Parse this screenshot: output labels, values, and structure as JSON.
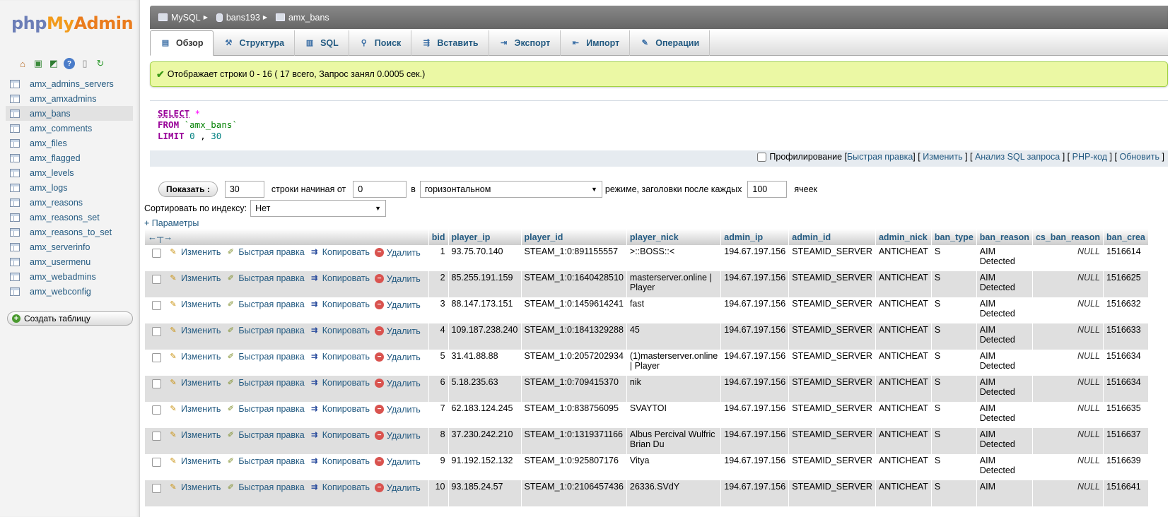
{
  "logo": {
    "php": "php",
    "my": "My",
    "admin": "Admin"
  },
  "nav_icons": [
    "home-icon",
    "exit-icon",
    "sql-query-icon",
    "help-icon",
    "docs-icon",
    "reload-icon"
  ],
  "sidebar": {
    "tables": [
      "amx_admins_servers",
      "amx_amxadmins",
      "amx_bans",
      "amx_comments",
      "amx_files",
      "amx_flagged",
      "amx_levels",
      "amx_logs",
      "amx_reasons",
      "amx_reasons_set",
      "amx_reasons_to_set",
      "amx_serverinfo",
      "amx_usermenu",
      "amx_webadmins",
      "amx_webconfig"
    ],
    "active_table": "amx_bans",
    "create_table": "Создать таблицу"
  },
  "breadcrumb": {
    "server": "MySQL",
    "database": "bans193",
    "table": "amx_bans"
  },
  "tabs": [
    {
      "label": "Обзор",
      "icon": "browse-icon",
      "active": true
    },
    {
      "label": "Структура",
      "icon": "structure-icon"
    },
    {
      "label": "SQL",
      "icon": "sql-icon"
    },
    {
      "label": "Поиск",
      "icon": "search-icon"
    },
    {
      "label": "Вставить",
      "icon": "insert-icon"
    },
    {
      "label": "Экспорт",
      "icon": "export-icon"
    },
    {
      "label": "Импорт",
      "icon": "import-icon"
    },
    {
      "label": "Операции",
      "icon": "operations-icon"
    }
  ],
  "success_message": "Отображает строки 0 - 16 ( 17 всего, Запрос занял 0.0005 сек.)",
  "sql": {
    "select_kw": "SELECT",
    "select_val": " *",
    "from_kw": "FROM",
    "from_val": " `amx_bans`",
    "limit_kw": "LIMIT",
    "limit_a": " 0",
    "limit_sep": " , ",
    "limit_b": "30"
  },
  "sql_links": {
    "profiling": "Профилирование",
    "quick_edit": "Быстрая правка",
    "edit": "Изменить",
    "explain": "Анализ SQL запроса",
    "php_code": "PHP-код",
    "refresh": "Обновить"
  },
  "controls": {
    "show_button": "Показать :",
    "rows": "30",
    "rows_from_label": "строки начиная от",
    "start": "0",
    "in_label": "в",
    "mode": "горизонтальном",
    "mode_label": "режиме, заголовки после каждых",
    "repeat": "100",
    "cells_label": "ячеек"
  },
  "sort": {
    "label": "Сортировать по индексу:",
    "value": "Нет"
  },
  "options_link": "+ Параметры",
  "actions": {
    "edit": "Изменить",
    "quick_edit": "Быстрая правка",
    "copy": "Копировать",
    "delete": "Удалить"
  },
  "columns": [
    "bid",
    "player_ip",
    "player_id",
    "player_nick",
    "admin_ip",
    "admin_id",
    "admin_nick",
    "ban_type",
    "ban_reason",
    "cs_ban_reason",
    "ban_crea"
  ],
  "rows": [
    {
      "bid": "1",
      "player_ip": "93.75.70.140",
      "player_id": "STEAM_1:0:891155557",
      "player_nick": ">::BOSS::<",
      "admin_ip": "194.67.197.156",
      "admin_id": "STEAMID_SERVER",
      "admin_nick": "ANTICHEAT",
      "ban_type": "S",
      "ban_reason": "AIM Detected",
      "cs_ban_reason": "NULL",
      "ban_created": "1516614"
    },
    {
      "bid": "2",
      "player_ip": "85.255.191.159",
      "player_id": "STEAM_1:0:1640428510",
      "player_nick": "masterserver.online | Player",
      "admin_ip": "194.67.197.156",
      "admin_id": "STEAMID_SERVER",
      "admin_nick": "ANTICHEAT",
      "ban_type": "S",
      "ban_reason": "AIM Detected",
      "cs_ban_reason": "NULL",
      "ban_created": "1516625"
    },
    {
      "bid": "3",
      "player_ip": "88.147.173.151",
      "player_id": "STEAM_1:0:1459614241",
      "player_nick": "fast",
      "admin_ip": "194.67.197.156",
      "admin_id": "STEAMID_SERVER",
      "admin_nick": "ANTICHEAT",
      "ban_type": "S",
      "ban_reason": "AIM Detected",
      "cs_ban_reason": "NULL",
      "ban_created": "1516632"
    },
    {
      "bid": "4",
      "player_ip": "109.187.238.240",
      "player_id": "STEAM_1:0:1841329288",
      "player_nick": "45",
      "admin_ip": "194.67.197.156",
      "admin_id": "STEAMID_SERVER",
      "admin_nick": "ANTICHEAT",
      "ban_type": "S",
      "ban_reason": "AIM Detected",
      "cs_ban_reason": "NULL",
      "ban_created": "1516633"
    },
    {
      "bid": "5",
      "player_ip": "31.41.88.88",
      "player_id": "STEAM_1:0:2057202934",
      "player_nick": "(1)masterserver.online | Player",
      "admin_ip": "194.67.197.156",
      "admin_id": "STEAMID_SERVER",
      "admin_nick": "ANTICHEAT",
      "ban_type": "S",
      "ban_reason": "AIM Detected",
      "cs_ban_reason": "NULL",
      "ban_created": "1516634"
    },
    {
      "bid": "6",
      "player_ip": "5.18.235.63",
      "player_id": "STEAM_1:0:709415370",
      "player_nick": "nik",
      "admin_ip": "194.67.197.156",
      "admin_id": "STEAMID_SERVER",
      "admin_nick": "ANTICHEAT",
      "ban_type": "S",
      "ban_reason": "AIM Detected",
      "cs_ban_reason": "NULL",
      "ban_created": "1516634"
    },
    {
      "bid": "7",
      "player_ip": "62.183.124.245",
      "player_id": "STEAM_1:0:838756095",
      "player_nick": "SVAYTOI",
      "admin_ip": "194.67.197.156",
      "admin_id": "STEAMID_SERVER",
      "admin_nick": "ANTICHEAT",
      "ban_type": "S",
      "ban_reason": "AIM Detected",
      "cs_ban_reason": "NULL",
      "ban_created": "1516635"
    },
    {
      "bid": "8",
      "player_ip": "37.230.242.210",
      "player_id": "STEAM_1:0:1319371166",
      "player_nick": "Albus Percival Wulfric Brian Du",
      "admin_ip": "194.67.197.156",
      "admin_id": "STEAMID_SERVER",
      "admin_nick": "ANTICHEAT",
      "ban_type": "S",
      "ban_reason": "AIM Detected",
      "cs_ban_reason": "NULL",
      "ban_created": "1516637"
    },
    {
      "bid": "9",
      "player_ip": "91.192.152.132",
      "player_id": "STEAM_1:0:925807176",
      "player_nick": "Vitya",
      "admin_ip": "194.67.197.156",
      "admin_id": "STEAMID_SERVER",
      "admin_nick": "ANTICHEAT",
      "ban_type": "S",
      "ban_reason": "AIM Detected",
      "cs_ban_reason": "NULL",
      "ban_created": "1516639"
    },
    {
      "bid": "10",
      "player_ip": "93.185.24.57",
      "player_id": "STEAM_1:0:2106457436",
      "player_nick": "26336.SVdY",
      "admin_ip": "194.67.197.156",
      "admin_id": "STEAMID_SERVER",
      "admin_nick": "ANTICHEAT",
      "ban_type": "S",
      "ban_reason": "AIM",
      "cs_ban_reason": "NULL",
      "ban_created": "1516641"
    }
  ]
}
